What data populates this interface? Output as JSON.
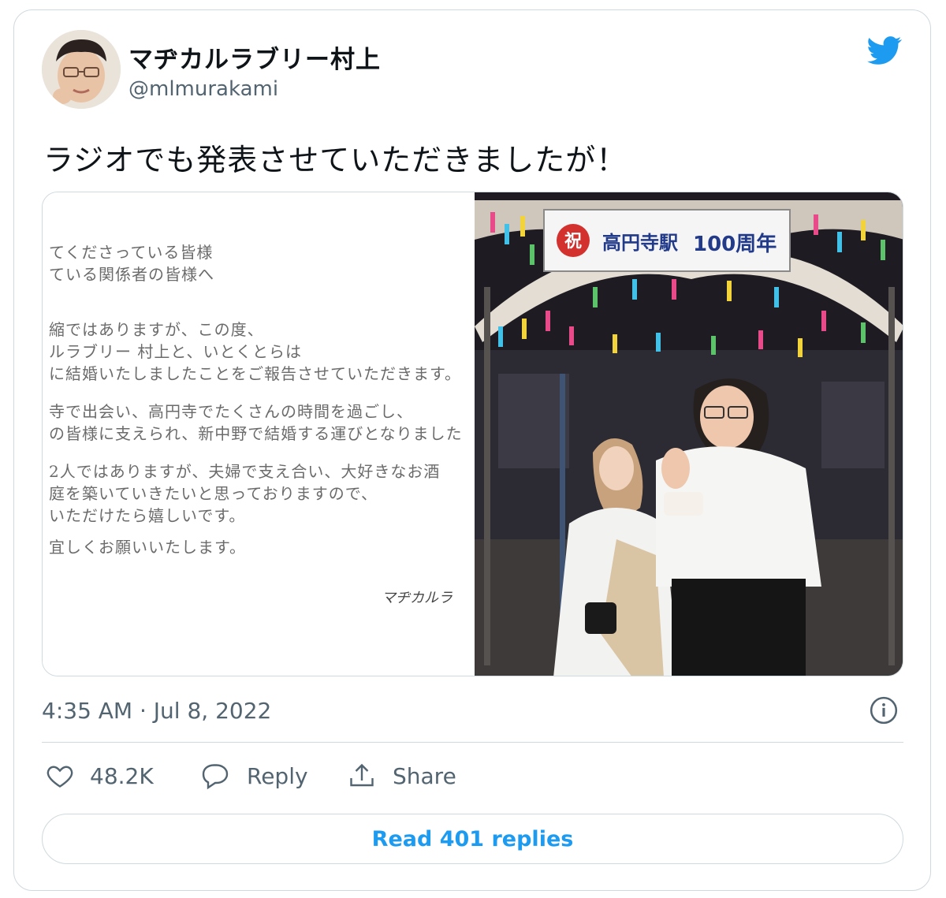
{
  "tweet": {
    "display_name": "マヂカルラブリー村上",
    "handle": "@mlmurakami",
    "text": "ラジオでも発表させていただきましたが！",
    "timestamp": "4:35 AM · Jul 8, 2022"
  },
  "media": {
    "letter_lines": [
      "てくださっている皆様",
      "ている関係者の皆様へ",
      "縮ではありますが、この度、",
      "ルラブリー 村上と、いとくとらは",
      "に結婚いたしましたことをご報告させていただきます。",
      "寺で出会い、高円寺でたくさんの時間を過ごし、",
      "の皆様に支えられ、新中野で結婚する運びとなりました",
      "2人ではありますが、夫婦で支え合い、大好きなお酒",
      "庭を築いていきたいと思っておりますので、",
      "いただけたら嬉しいです。",
      "宜しくお願いいたします。"
    ],
    "signature": "マヂカルラ",
    "banner_kanji": "祝",
    "banner_text": "高円寺駅",
    "banner_number": "100周年"
  },
  "actions": {
    "likes": "48.2K",
    "reply_label": "Reply",
    "share_label": "Share"
  },
  "read_replies_label": "Read 401 replies",
  "colors": {
    "brand_blue": "#1d9bf0",
    "secondary_text": "#536471",
    "border": "#cfd9de"
  }
}
